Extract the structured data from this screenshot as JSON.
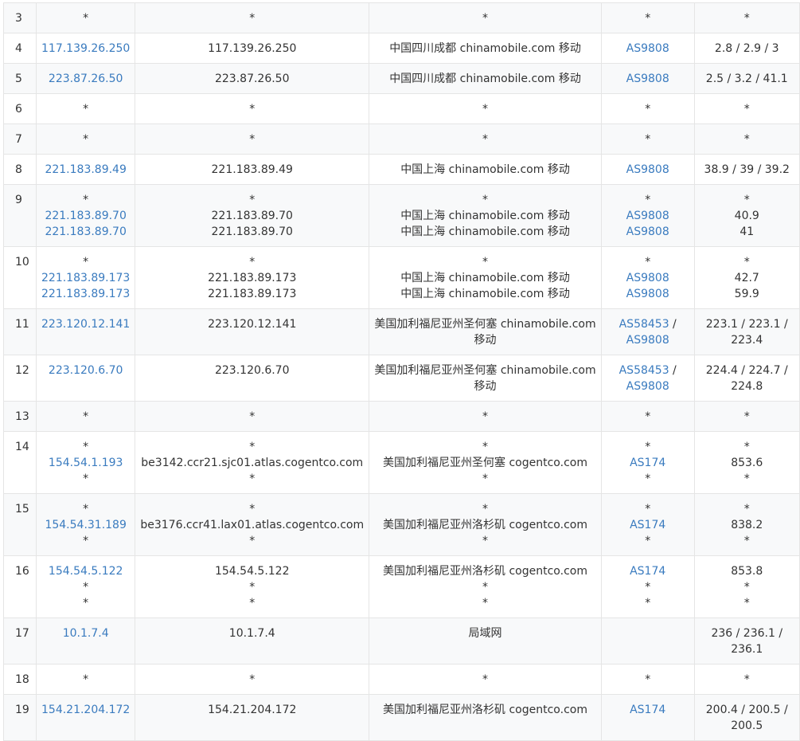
{
  "rows": [
    {
      "hop": "3",
      "ip": [
        "*"
      ],
      "host": [
        "*"
      ],
      "loc": [
        "*"
      ],
      "asn": [
        [
          "*"
        ]
      ],
      "rtt": [
        "*"
      ]
    },
    {
      "hop": "4",
      "ip": [
        "117.139.26.250"
      ],
      "host": [
        "117.139.26.250"
      ],
      "loc": [
        "中国四川成都 chinamobile.com 移动"
      ],
      "asn": [
        [
          "AS9808"
        ]
      ],
      "rtt": [
        "2.8 / 2.9 / 3"
      ]
    },
    {
      "hop": "5",
      "ip": [
        "223.87.26.50"
      ],
      "host": [
        "223.87.26.50"
      ],
      "loc": [
        "中国四川成都 chinamobile.com 移动"
      ],
      "asn": [
        [
          "AS9808"
        ]
      ],
      "rtt": [
        "2.5 / 3.2 / 41.1"
      ]
    },
    {
      "hop": "6",
      "ip": [
        "*"
      ],
      "host": [
        "*"
      ],
      "loc": [
        "*"
      ],
      "asn": [
        [
          "*"
        ]
      ],
      "rtt": [
        "*"
      ]
    },
    {
      "hop": "7",
      "ip": [
        "*"
      ],
      "host": [
        "*"
      ],
      "loc": [
        "*"
      ],
      "asn": [
        [
          "*"
        ]
      ],
      "rtt": [
        "*"
      ]
    },
    {
      "hop": "8",
      "ip": [
        "221.183.89.49"
      ],
      "host": [
        "221.183.89.49"
      ],
      "loc": [
        "中国上海 chinamobile.com 移动"
      ],
      "asn": [
        [
          "AS9808"
        ]
      ],
      "rtt": [
        "38.9 / 39 / 39.2"
      ]
    },
    {
      "hop": "9",
      "ip": [
        "*",
        "221.183.89.70",
        "221.183.89.70"
      ],
      "host": [
        "*",
        "221.183.89.70",
        "221.183.89.70"
      ],
      "loc": [
        "*",
        "中国上海 chinamobile.com 移动",
        "中国上海 chinamobile.com 移动"
      ],
      "asn": [
        [
          "*"
        ],
        [
          "AS9808"
        ],
        [
          "AS9808"
        ]
      ],
      "rtt": [
        "*",
        "40.9",
        "41"
      ]
    },
    {
      "hop": "10",
      "ip": [
        "*",
        "221.183.89.173",
        "221.183.89.173"
      ],
      "host": [
        "*",
        "221.183.89.173",
        "221.183.89.173"
      ],
      "loc": [
        "*",
        "中国上海 chinamobile.com 移动",
        "中国上海 chinamobile.com 移动"
      ],
      "asn": [
        [
          "*"
        ],
        [
          "AS9808"
        ],
        [
          "AS9808"
        ]
      ],
      "rtt": [
        "*",
        "42.7",
        "59.9"
      ]
    },
    {
      "hop": "11",
      "ip": [
        "223.120.12.141"
      ],
      "host": [
        "223.120.12.141"
      ],
      "loc": [
        "美国加利福尼亚州圣何塞 chinamobile.com",
        "移动"
      ],
      "asn": [
        [
          "AS58453",
          " /"
        ],
        [
          "AS9808"
        ]
      ],
      "rtt": [
        "223.1 / 223.1 /",
        "223.4"
      ]
    },
    {
      "hop": "12",
      "ip": [
        "223.120.6.70"
      ],
      "host": [
        "223.120.6.70"
      ],
      "loc": [
        "美国加利福尼亚州圣何塞 chinamobile.com",
        "移动"
      ],
      "asn": [
        [
          "AS58453",
          " /"
        ],
        [
          "AS9808"
        ]
      ],
      "rtt": [
        "224.4 / 224.7 /",
        "224.8"
      ]
    },
    {
      "hop": "13",
      "ip": [
        "*"
      ],
      "host": [
        "*"
      ],
      "loc": [
        "*"
      ],
      "asn": [
        [
          "*"
        ]
      ],
      "rtt": [
        "*"
      ]
    },
    {
      "hop": "14",
      "ip": [
        "*",
        "154.54.1.193",
        "*"
      ],
      "host": [
        "*",
        "be3142.ccr21.sjc01.atlas.cogentco.com",
        "*"
      ],
      "loc": [
        "*",
        "美国加利福尼亚州圣何塞 cogentco.com",
        "*"
      ],
      "asn": [
        [
          "*"
        ],
        [
          "AS174"
        ],
        [
          "*"
        ]
      ],
      "rtt": [
        "*",
        "853.6",
        "*"
      ]
    },
    {
      "hop": "15",
      "ip": [
        "*",
        "154.54.31.189",
        "*"
      ],
      "host": [
        "*",
        "be3176.ccr41.lax01.atlas.cogentco.com",
        "*"
      ],
      "loc": [
        "*",
        "美国加利福尼亚州洛杉矶 cogentco.com",
        "*"
      ],
      "asn": [
        [
          "*"
        ],
        [
          "AS174"
        ],
        [
          "*"
        ]
      ],
      "rtt": [
        "*",
        "838.2",
        "*"
      ]
    },
    {
      "hop": "16",
      "ip": [
        "154.54.5.122",
        "*",
        "*"
      ],
      "host": [
        "154.54.5.122",
        "*",
        "*"
      ],
      "loc": [
        "美国加利福尼亚州洛杉矶 cogentco.com",
        "*",
        "*"
      ],
      "asn": [
        [
          "AS174"
        ],
        [
          "*"
        ],
        [
          "*"
        ]
      ],
      "rtt": [
        "853.8",
        "*",
        "*"
      ]
    },
    {
      "hop": "17",
      "ip": [
        "10.1.7.4"
      ],
      "host": [
        "10.1.7.4"
      ],
      "loc": [
        "局域网"
      ],
      "asn": [],
      "rtt": [
        "236 / 236.1 /",
        "236.1"
      ]
    },
    {
      "hop": "18",
      "ip": [
        "*"
      ],
      "host": [
        "*"
      ],
      "loc": [
        "*"
      ],
      "asn": [
        [
          "*"
        ]
      ],
      "rtt": [
        "*"
      ]
    },
    {
      "hop": "19",
      "ip": [
        "154.21.204.172"
      ],
      "host": [
        "154.21.204.172"
      ],
      "loc": [
        "美国加利福尼亚州洛杉矶 cogentco.com"
      ],
      "asn": [
        [
          "AS174"
        ]
      ],
      "rtt": [
        "200.4 / 200.5 /",
        "200.5"
      ]
    }
  ]
}
